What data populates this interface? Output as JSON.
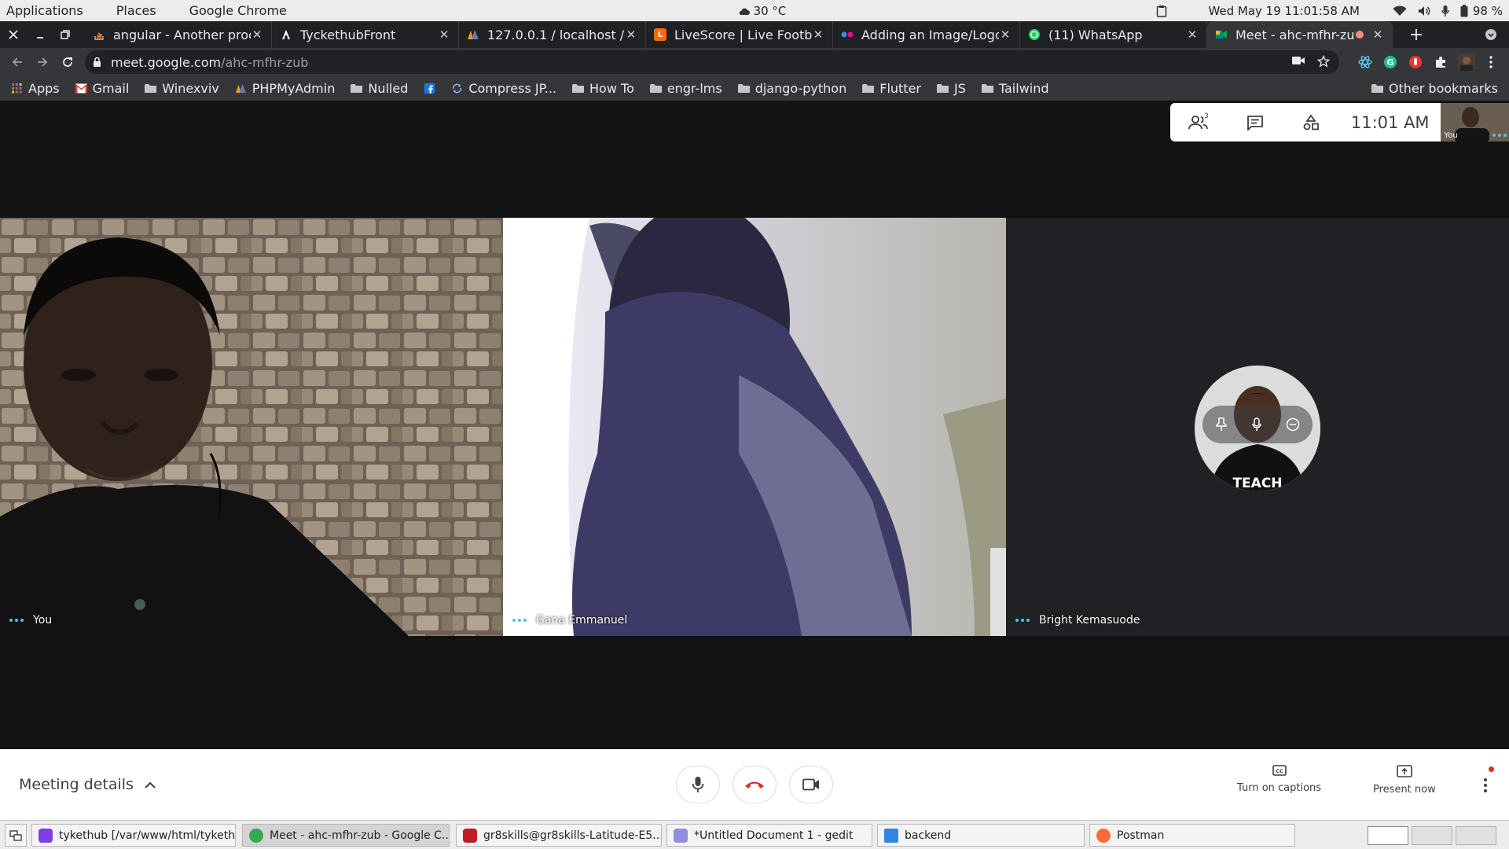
{
  "topbar": {
    "menus": [
      "Applications",
      "Places",
      "Google Chrome"
    ],
    "weather": "30 °C",
    "datetime": "Wed May 19  11:01:58 AM",
    "battery": "98 %"
  },
  "tabs": [
    {
      "title": "angular - Another proc",
      "favicon": "stackoverflow-icon",
      "color": "#f48024"
    },
    {
      "title": "TyckethubFront",
      "favicon": "angular-icon",
      "color": "#ffffff"
    },
    {
      "title": "127.0.0.1 / localhost / ",
      "favicon": "phpmyadmin-icon",
      "color": "#f89c0e"
    },
    {
      "title": "LiveScore | Live Footba",
      "favicon": "livescore-icon",
      "color": "#ff6d00"
    },
    {
      "title": "Adding an Image/Logo",
      "favicon": "flickr-icon",
      "color": "#4285f4"
    },
    {
      "title": "(11) WhatsApp",
      "favicon": "whatsapp-icon",
      "color": "#25d366"
    },
    {
      "title": "Meet - ahc-mfhr-zub",
      "favicon": "meet-icon",
      "color": "#00897b"
    }
  ],
  "omnibox": {
    "host": "meet.google.com",
    "path": "/ahc-mfhr-zub"
  },
  "bookmarks": {
    "items": [
      {
        "label": "Apps",
        "icon": "apps-grid-icon"
      },
      {
        "label": "Gmail",
        "icon": "gmail-icon"
      },
      {
        "label": "Winexviv",
        "icon": "folder-icon"
      },
      {
        "label": "PHPMyAdmin",
        "icon": "phpmyadmin-icon"
      },
      {
        "label": "Nulled",
        "icon": "folder-icon"
      },
      {
        "label": "",
        "icon": "facebook-icon"
      },
      {
        "label": "Compress JP...",
        "icon": "compress-icon"
      },
      {
        "label": "How To",
        "icon": "folder-icon"
      },
      {
        "label": "engr-lms",
        "icon": "folder-icon"
      },
      {
        "label": "django-python",
        "icon": "folder-icon"
      },
      {
        "label": "Flutter",
        "icon": "folder-icon"
      },
      {
        "label": "JS",
        "icon": "folder-icon"
      },
      {
        "label": "Tailwind",
        "icon": "folder-icon"
      }
    ],
    "other": "Other bookmarks"
  },
  "meet": {
    "participant_count": "3",
    "clock": "11:01  AM",
    "self_label": "You",
    "tiles": [
      {
        "name": "You"
      },
      {
        "name": "Gana Emmanuel"
      },
      {
        "name": "Bright Kemasuode"
      }
    ],
    "avatar_shirt_text": "TEACH",
    "details_label": "Meeting details",
    "captions_label": "Turn on captions",
    "present_label": "Present now"
  },
  "taskbar": {
    "tasks": [
      {
        "label": "tykethub [/var/www/html/tyketh...",
        "icon": "phpstorm-icon",
        "color": "#7b3fe4"
      },
      {
        "label": "Meet - ahc-mfhr-zub - Google C...",
        "icon": "chrome-icon",
        "color": "#34a853"
      },
      {
        "label": "gr8skills@gr8skills-Latitude-E5...",
        "icon": "terminal-icon",
        "color": "#c01c28"
      },
      {
        "label": "*Untitled Document 1 - gedit",
        "icon": "gedit-icon",
        "color": "#8f8fdc"
      },
      {
        "label": "backend",
        "icon": "folder-icon",
        "color": "#3584e4"
      },
      {
        "label": "Postman",
        "icon": "postman-icon",
        "color": "#ff6c37"
      }
    ]
  }
}
